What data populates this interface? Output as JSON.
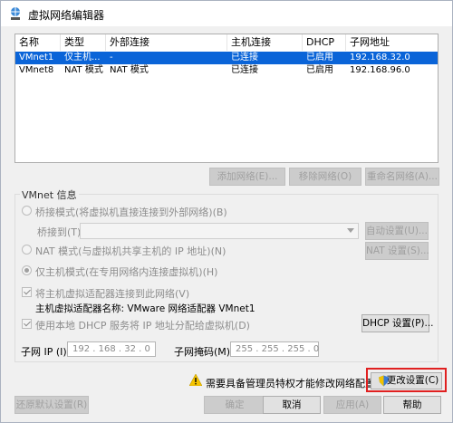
{
  "window": {
    "title": "虚拟网络编辑器"
  },
  "network_table": {
    "columns": [
      "名称",
      "类型",
      "外部连接",
      "主机连接",
      "DHCP",
      "子网地址"
    ],
    "rows": [
      {
        "name": "VMnet1",
        "type": "仅主机...",
        "external": "-",
        "host": "已连接",
        "dhcp": "已启用",
        "subnet": "192.168.32.0",
        "selected": true
      },
      {
        "name": "VMnet8",
        "type": "NAT 模式",
        "external": "NAT 模式",
        "host": "已连接",
        "dhcp": "已启用",
        "subnet": "192.168.96.0",
        "selected": false
      }
    ]
  },
  "table_buttons": {
    "add": "添加网络(E)...",
    "remove": "移除网络(O)",
    "rename": "重命名网络(A)..."
  },
  "vmnet_info": {
    "title": "VMnet 信息",
    "bridged": "桥接模式(将虚拟机直接连接到外部网络)(B)",
    "bridged_to_label": "桥接到(T):",
    "bridged_to_value": "",
    "auto_settings": "自动设置(U)...",
    "nat": "NAT 模式(与虚拟机共享主机的 IP 地址)(N)",
    "nat_settings": "NAT 设置(S)...",
    "host_only": "仅主机模式(在专用网络内连接虚拟机)(H)",
    "connect_adapter": "将主机虚拟适配器连接到此网络(V)",
    "adapter_name": "主机虚拟适配器名称: VMware 网络适配器 VMnet1",
    "use_dhcp": "使用本地 DHCP 服务将 IP 地址分配给虚拟机(D)",
    "dhcp_settings": "DHCP 设置(P)...",
    "subnet_ip_label": "子网 IP (I):",
    "subnet_ip_value": "192 . 168 . 32 . 0",
    "subnet_mask_label": "子网掩码(M):",
    "subnet_mask_value": "255 . 255 . 255 . 0"
  },
  "admin": {
    "warning": "需要具备管理员特权才能修改网络配置。",
    "change_settings": "更改设置(C)"
  },
  "footer_buttons": {
    "restore": "还原默认设置(R)",
    "ok": "确定",
    "cancel": "取消",
    "apply": "应用(A)",
    "help": "帮助"
  },
  "colors": {
    "selection": "#0a64d8",
    "highlight": "#e02020"
  }
}
